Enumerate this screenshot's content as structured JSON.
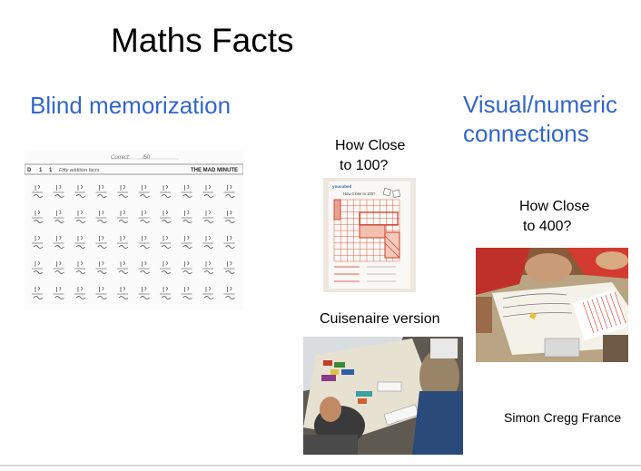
{
  "slide": {
    "title": "Maths Facts",
    "left_heading": "Blind memorization",
    "right_heading_line1": "Visual/numeric",
    "right_heading_line2": "connections",
    "caption_100_line1": "How Close",
    "caption_100_line2": "to 100?",
    "caption_400_line1": "How Close",
    "caption_400_line2": "to 400?",
    "caption_cuisenaire": "Cuisenaire version",
    "credit": "Simon Cregg France"
  },
  "worksheet": {
    "header_correct": "Correct:",
    "header_score": "/50",
    "row_label_d": "D",
    "row_label_1": "1",
    "row_label_2": "1",
    "subtitle": "Fifty addition facts",
    "brand": "THE MAD MINUTE"
  },
  "grid100": {
    "title": "How Close to 100?"
  },
  "colors": {
    "title": "#000000",
    "heading_blue": "#3366cc",
    "grid_red": "#d23a2a"
  },
  "icons": {
    "worksheet_photo": "worksheet-photo-icon",
    "grid_photo": "grid-photo-icon",
    "classroom_photo": "classroom-photo-icon",
    "cuisenaire_photo": "cuisenaire-photo-icon"
  }
}
